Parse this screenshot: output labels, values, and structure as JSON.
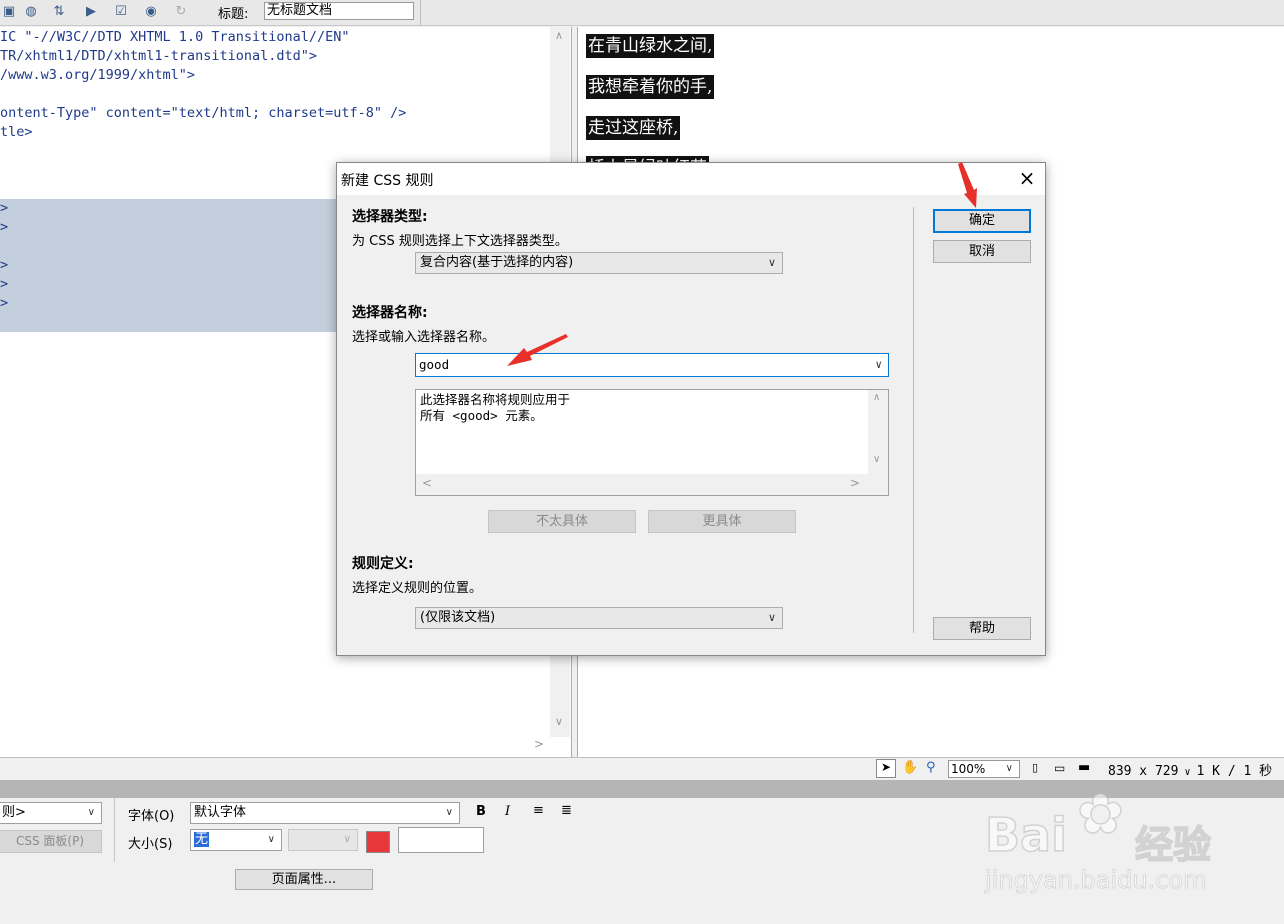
{
  "toolbar": {
    "title_label": "标题:",
    "title_value": "无标题文档"
  },
  "code": {
    "lines": [
      "IC \"-//W3C//DTD XHTML 1.0 Transitional//EN\"",
      "TR/xhtml1/DTD/xhtml1-transitional.dtd\">",
      "/www.w3.org/1999/xhtml\">",
      "",
      "ontent-Type\" content=\"text/html; charset=utf-8\" />",
      "tle>"
    ],
    "selected_marks": [
      ">",
      ">",
      ">",
      ">",
      ">"
    ]
  },
  "design": {
    "lines": [
      "在青山绿水之间,",
      "我想牵着你的手,",
      "走过这座桥,",
      "桥上是绿叶红花"
    ]
  },
  "status": {
    "zoom": "100%",
    "dims": "839 x 729",
    "size": "1 K / 1 秒"
  },
  "properties": {
    "format_value": "则>",
    "css_panel_button": "CSS 面板(P)",
    "font_label": "字体(O)",
    "font_value": "默认字体",
    "size_label": "大小(S)",
    "size_value": "无",
    "bold": "B",
    "italic": "I",
    "page_props_button": "页面属性...",
    "color": "#e8383b"
  },
  "dialog": {
    "title": "新建 CSS 规则",
    "close": "×",
    "selector_type_title": "选择器类型:",
    "selector_type_desc": "为 CSS 规则选择上下文选择器类型。",
    "selector_type_value": "复合内容(基于选择的内容)",
    "selector_name_title": "选择器名称:",
    "selector_name_desc": "选择或输入选择器名称。",
    "selector_name_value": "good",
    "description_text": "此选择器名称将规则应用于\n所有 <good> 元素。",
    "less_specific": "不太具体",
    "more_specific": "更具体",
    "rule_def_title": "规则定义:",
    "rule_def_desc": "选择定义规则的位置。",
    "rule_def_value": "(仅限该文档)",
    "ok": "确定",
    "cancel": "取消",
    "help": "帮助"
  },
  "watermark": {
    "brand": "Bai",
    "brand_cn": "经验",
    "url": "jingyan.baidu.com"
  },
  "colors": {
    "selection": "#c3cfdc",
    "ok_border": "#0078d7",
    "annotation_arrow": "#e8302a"
  }
}
